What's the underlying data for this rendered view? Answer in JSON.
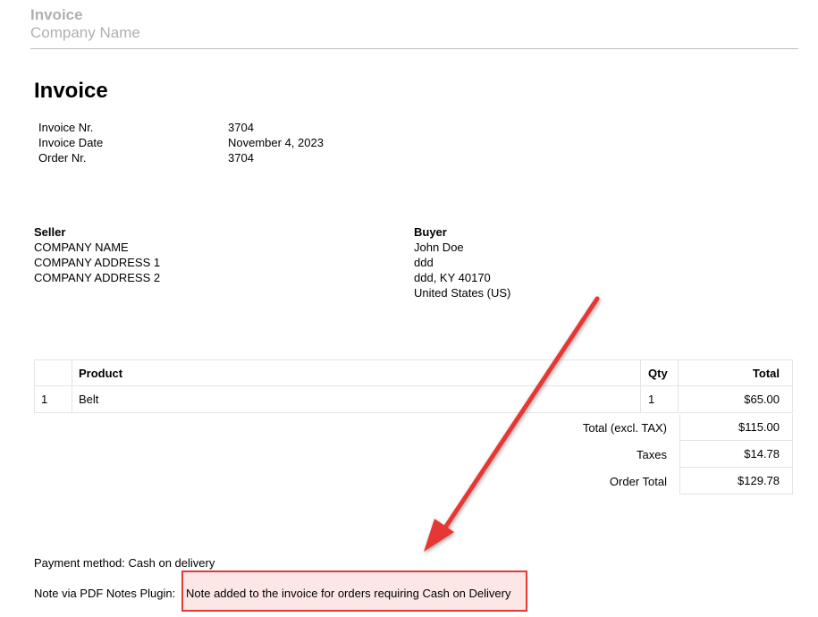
{
  "header": {
    "title": "Invoice",
    "company": "Company Name"
  },
  "document": {
    "title": "Invoice"
  },
  "meta": [
    {
      "label": "Invoice Nr.",
      "value": "3704"
    },
    {
      "label": "Invoice Date",
      "value": "November 4, 2023"
    },
    {
      "label": "Order Nr.",
      "value": "3704"
    }
  ],
  "seller": {
    "heading": "Seller",
    "lines": [
      "COMPANY NAME",
      "COMPANY ADDRESS 1",
      "COMPANY ADDRESS 2"
    ]
  },
  "buyer": {
    "heading": "Buyer",
    "lines": [
      "John Doe",
      "ddd",
      "ddd, KY 40170",
      "United States (US)"
    ]
  },
  "items": {
    "headers": {
      "num": "",
      "product": "Product",
      "qty": "Qty",
      "total": "Total"
    },
    "rows": [
      {
        "num": "1",
        "product": "Belt",
        "qty": "1",
        "total": "$65.00"
      }
    ]
  },
  "totals": [
    {
      "label": "Total (excl. TAX)",
      "value": "$115.00"
    },
    {
      "label": "Taxes",
      "value": "$14.78"
    },
    {
      "label": "Order Total",
      "value": "$129.78"
    }
  ],
  "payment": "Payment method: Cash on delivery",
  "note": {
    "label": "Note via PDF Notes Plugin:",
    "text": "Note added to the invoice for orders requiring Cash on Delivery"
  },
  "colors": {
    "annotation": "#e53935",
    "header_text": "#b0b0b0"
  }
}
